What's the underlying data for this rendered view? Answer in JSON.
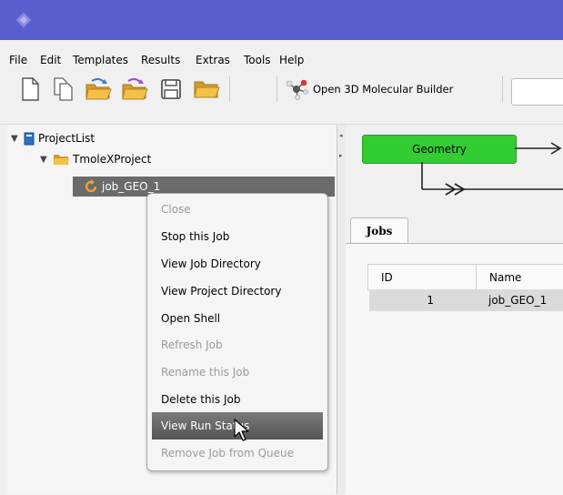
{
  "menu": [
    "File",
    "Edit",
    "Templates",
    "Results",
    "Extras",
    "Tools",
    "Help"
  ],
  "toolbar": {
    "molecular_builder_label": "Open 3D Molecular Builder"
  },
  "tree": {
    "root": "ProjectList",
    "project": "TmoleXProject",
    "job": "job_GEO_1"
  },
  "workflow": {
    "geometry_label": "Geometry",
    "geometry_color": "#33cc33"
  },
  "tabs": {
    "jobs": "Jobs"
  },
  "table": {
    "headers": [
      "ID",
      "Name"
    ],
    "rows": [
      {
        "id": "1",
        "name": "job_GEO_1"
      }
    ]
  },
  "context_menu": {
    "items": [
      {
        "label": "Close",
        "enabled": false
      },
      {
        "label": "Stop this Job",
        "enabled": true
      },
      {
        "label": "View Job Directory",
        "enabled": true
      },
      {
        "label": "View Project Directory",
        "enabled": true
      },
      {
        "label": "Open Shell",
        "enabled": true
      },
      {
        "label": "Refresh Job",
        "enabled": false
      },
      {
        "label": "Rename this Job",
        "enabled": false
      },
      {
        "label": "Delete this Job",
        "enabled": true
      },
      {
        "label": "View Run Status",
        "enabled": true,
        "highlighted": true
      },
      {
        "label": "Remove Job from Queue",
        "enabled": false
      }
    ]
  },
  "colors": {
    "titlebar": "#5a5fcf",
    "selection": "#6b6b6b",
    "folder": "#f0b43c"
  }
}
